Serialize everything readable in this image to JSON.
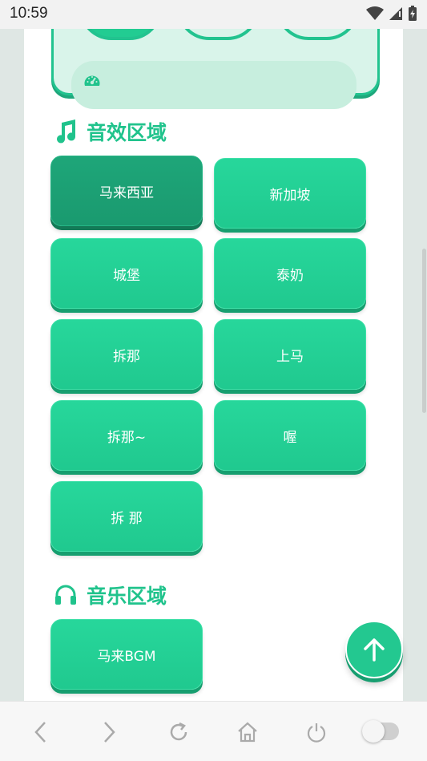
{
  "status_bar": {
    "time": "10:59"
  },
  "sections": {
    "sound_effects": {
      "title": "音效区域",
      "icon": "music-note-icon",
      "buttons": [
        "马来西亚",
        "新加坡",
        "城堡",
        "泰奶",
        "拆那",
        "上马",
        "拆那~",
        "喔",
        "拆 那"
      ],
      "active_index": 0
    },
    "music": {
      "title": "音乐区域",
      "icon": "headphones-icon",
      "buttons": [
        "马来BGM"
      ]
    }
  },
  "top_panel": {
    "icon": "gauge-icon"
  },
  "fab": {
    "icon": "arrow-up-icon"
  },
  "nav_bar": {
    "items": [
      "back-icon",
      "forward-icon",
      "reload-icon",
      "home-icon",
      "power-icon",
      "toggle-switch"
    ],
    "toggle_on": false
  },
  "colors": {
    "accent": "#22c38f",
    "accent_dark": "#1a9a6f",
    "panel_bg": "#d9f4ea"
  }
}
